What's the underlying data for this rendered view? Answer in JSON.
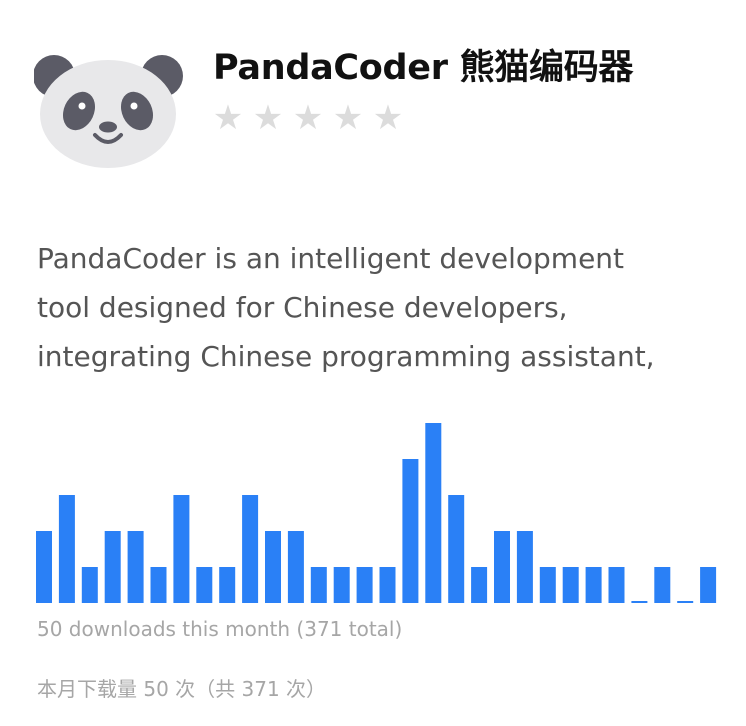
{
  "app": {
    "title": "PandaCoder 熊猫编码器",
    "logo_icon": "panda-face-icon",
    "rating": {
      "filled": 0,
      "max": 5,
      "star_glyph": "★"
    },
    "description_lines": [
      "PandaCoder is an intelligent development",
      "tool designed for Chinese developers,",
      "integrating Chinese programming assistant,"
    ],
    "stats": {
      "downloads_en": "50 downloads this month (371 total)",
      "downloads_zh": "本月下载量 50 次（共 371 次）"
    }
  },
  "chart_data": {
    "type": "bar",
    "series": [
      {
        "values": [
          2,
          3,
          1,
          2,
          2,
          1,
          3,
          1,
          1,
          3,
          2,
          2,
          1,
          1,
          1,
          1,
          4,
          5,
          3,
          1,
          2,
          2,
          1,
          1,
          1,
          1,
          0,
          1,
          0,
          1
        ]
      }
    ],
    "ylim": [
      0,
      5
    ],
    "color": "#2a80f6",
    "grid": false
  }
}
